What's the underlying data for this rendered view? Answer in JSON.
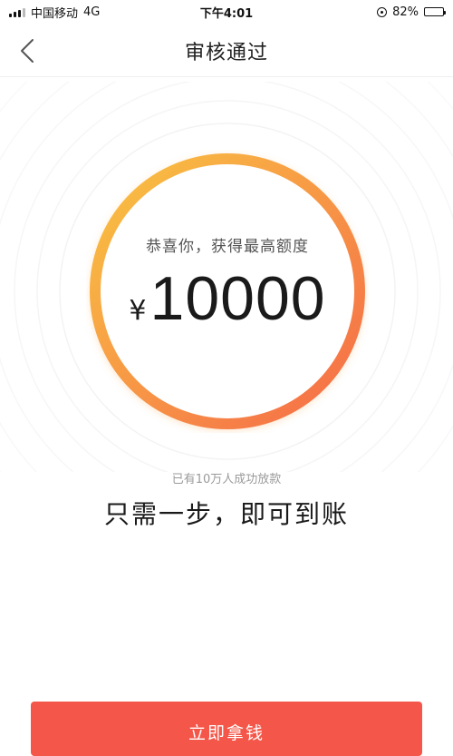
{
  "status_bar": {
    "carrier": "中国移动",
    "network": "4G",
    "time": "下午4:01",
    "battery": "82%",
    "battery_level": 0.82
  },
  "nav": {
    "title": "审核通过",
    "back_icon": "chevron-left-icon"
  },
  "result": {
    "congrats": "恭喜你，获得最高额度",
    "currency": "¥",
    "amount": "10000",
    "ring_gradient": [
      "#f9c442",
      "#f56a48"
    ]
  },
  "info": {
    "note": "已有10万人成功放款",
    "tagline": "只需一步，即可到账"
  },
  "cta": {
    "label": "立即拿钱",
    "color": "#f4574a"
  }
}
